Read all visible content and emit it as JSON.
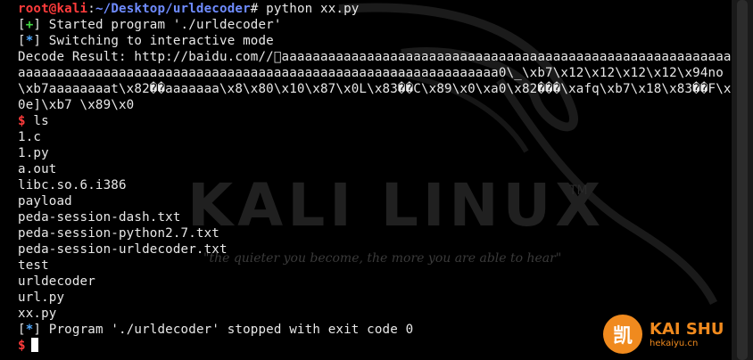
{
  "terminal": {
    "prompt_user": "root@kali",
    "prompt_sep": ":",
    "prompt_path": "~/Desktop/urldecoder",
    "prompt_hash": "#",
    "command": " python xx.py",
    "lines": [
      {
        "tag_mark": "+",
        "text": " Started program './urldecoder'"
      },
      {
        "tag_mark": "*",
        "text": " Switching to interactive mode"
      }
    ],
    "decode_result": " Decode Result: http://baidu.com//\u0000aaaaaaaaaaaaaaaaaaaaaaaaaaaaaaaaaaaaaaaaaaaaaaaaaaaaaaaaaaaaaaaaaaaaaaaaaaaaaaaaaaaaaaaaaaaaaaaaaaaaaaaaaaaaaaaaaaaaaaaa0\\_\\xb7\\x12\\x12\\x12\\x12\\x94no\\xb7aaaaaaaat\\x82��aaaaaaa\\x8\\x80\\x10\\x87\\x0L\\x83��C\\x89\\x0\\xa0\\x82���\\xafq\\xb7\\x18\\x83��F\\x0e]\\xb7 \\x89\\x0",
    "ls_prompt": "$",
    "ls_cmd": " ls",
    "files": [
      "1.c",
      "1.py",
      "a.out",
      "libc.so.6.i386",
      "payload",
      "peda-session-dash.txt",
      "peda-session-python2.7.txt",
      "peda-session-urldecoder.txt",
      "test",
      "urldecoder",
      "url.py",
      "xx.py"
    ],
    "final_mark": "*",
    "final_text": " Program './urldecoder' stopped with exit code 0",
    "end_prompt": "$"
  },
  "watermark": {
    "brand": "KALI LINUX",
    "tm": "TM",
    "quote": "\"the quieter you become, the more you are able to hear\""
  },
  "logo": {
    "glyph": "凯",
    "name": "KAI SHU",
    "url": "hekaiyu.cn"
  },
  "colors": {
    "background": "#000000",
    "prompt_user": "#ff3b3b",
    "path": "#6f8cff",
    "plus": "#43d843",
    "star": "#4fa9ff",
    "accent": "#f08a1e"
  }
}
